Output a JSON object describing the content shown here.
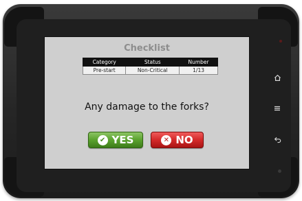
{
  "app": {
    "title": "Checklist"
  },
  "checklist_table": {
    "headers": [
      "Category",
      "Status",
      "Number"
    ],
    "row": [
      "Pre-start",
      "Non-Critical",
      "1/13"
    ]
  },
  "question": {
    "text": "Any damage to the forks?"
  },
  "buttons": {
    "yes_label": "YES",
    "no_label": "NO",
    "yes_icon": "check-circle-icon",
    "no_icon": "x-circle-icon",
    "yes_color": "#5aa22e",
    "no_color": "#d42a2a"
  },
  "device_buttons": {
    "home_icon": "home-icon",
    "menu_icon": "menu-icon",
    "back_icon": "back-icon"
  },
  "colors": {
    "screen_bg": "#cfcfcf",
    "title_color": "#8d8d8d",
    "table_header_bg": "#111111"
  }
}
